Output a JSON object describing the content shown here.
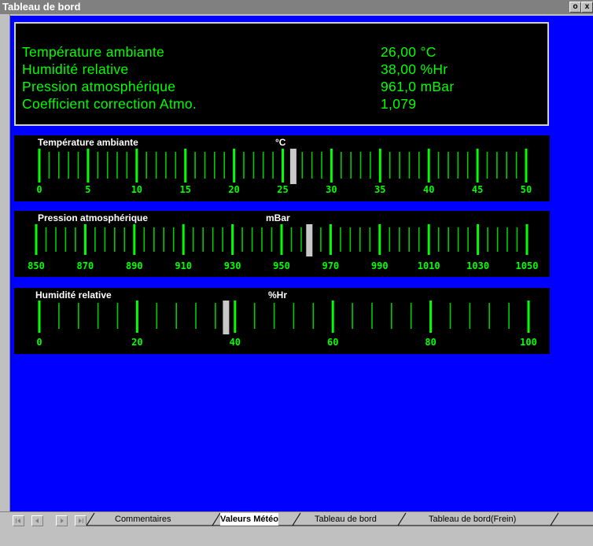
{
  "window": {
    "title": "Tableau de bord",
    "restore_btn": "o",
    "close_btn": "x"
  },
  "info": [
    {
      "label": "Température ambiante",
      "value": "26,00 °C"
    },
    {
      "label": "Humidité relative",
      "value": "38,00 %Hr"
    },
    {
      "label": "Pression atmosphérique",
      "value": "961,0 mBar"
    },
    {
      "label": "Coefficient correction Atmo.",
      "value": "1,079"
    }
  ],
  "gauges": [
    {
      "label": "Température ambiante",
      "unit": "°C",
      "min": 0,
      "max": 50,
      "ticks": [
        "0",
        "5",
        "10",
        "15",
        "20",
        "25",
        "30",
        "35",
        "40",
        "45",
        "50"
      ],
      "minor_per_major": 4,
      "value": 26
    },
    {
      "label": "Pression atmosphérique",
      "unit": "mBar",
      "min": 850,
      "max": 1050,
      "ticks": [
        "850",
        "870",
        "890",
        "910",
        "930",
        "950",
        "970",
        "990",
        "1010",
        "1030",
        "1050"
      ],
      "minor_per_major": 4,
      "value": 961
    },
    {
      "label": "Humidité relative",
      "unit": "%Hr",
      "min": 0,
      "max": 100,
      "ticks": [
        "0",
        "20",
        "40",
        "60",
        "80",
        "100"
      ],
      "minor_per_major": 4,
      "value": 38
    }
  ],
  "tabs": [
    "Commentaires",
    "Valeurs Météo",
    "Tableau de bord",
    "Tableau de bord(Frein)"
  ],
  "active_tab": 1,
  "colors": {
    "background": "#0000ff",
    "text": "#00ff00",
    "panel": "#000000",
    "cursor": "#c8c8c8",
    "ticks": "#00cc00"
  },
  "icons": {
    "nav": [
      "first-sheet-icon",
      "prev-sheet-icon",
      "next-sheet-icon",
      "last-sheet-icon"
    ]
  }
}
